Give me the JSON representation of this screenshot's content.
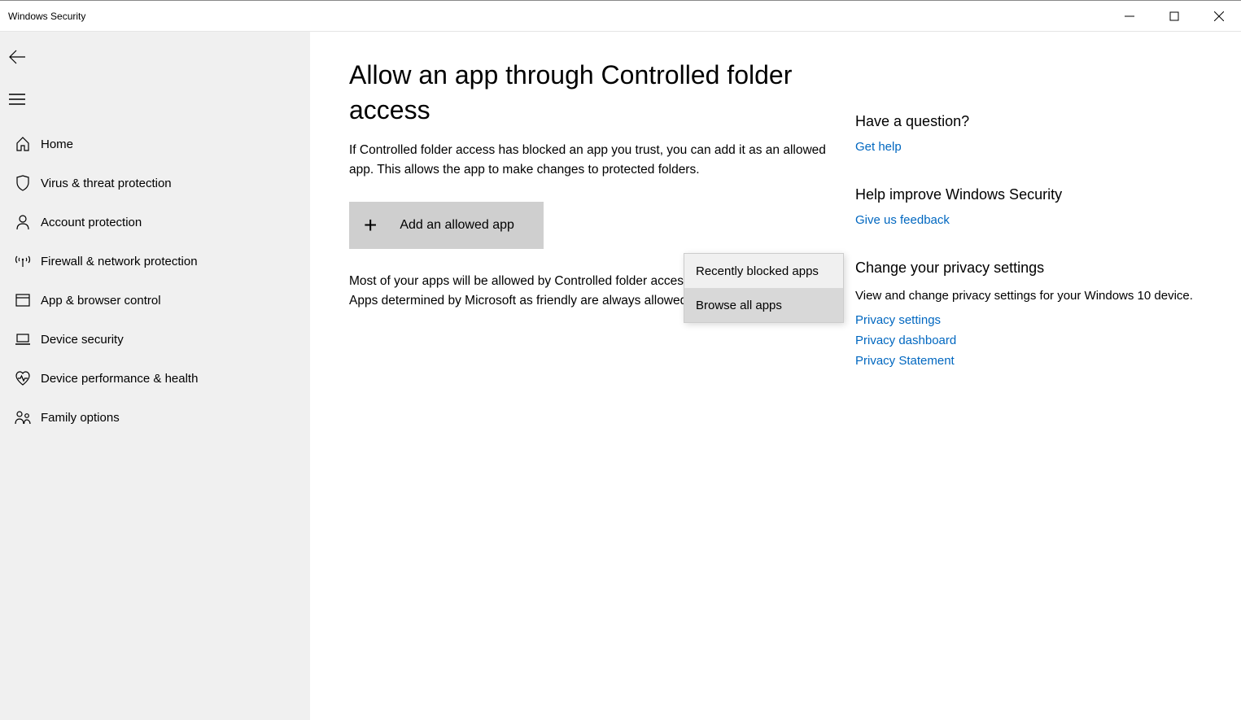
{
  "window": {
    "title": "Windows Security"
  },
  "sidebar": {
    "items": [
      {
        "label": "Home"
      },
      {
        "label": "Virus & threat protection"
      },
      {
        "label": "Account protection"
      },
      {
        "label": "Firewall & network protection"
      },
      {
        "label": "App & browser control"
      },
      {
        "label": "Device security"
      },
      {
        "label": "Device performance & health"
      },
      {
        "label": "Family options"
      }
    ]
  },
  "main": {
    "title": "Allow an app through Controlled folder access",
    "description": "If Controlled folder access has blocked an app you trust, you can add it as an allowed app. This allows the app to make changes to protected folders.",
    "add_button_label": "Add an allowed app",
    "sub_description": "Most of your apps will be allowed by Controlled folder access without adding them here. Apps determined by Microsoft as friendly are always allowed.",
    "dropdown": {
      "items": [
        "Recently blocked apps",
        "Browse all apps"
      ]
    }
  },
  "right": {
    "question": {
      "heading": "Have a question?",
      "link": "Get help"
    },
    "improve": {
      "heading": "Help improve Windows Security",
      "link": "Give us feedback"
    },
    "privacy": {
      "heading": "Change your privacy settings",
      "text": "View and change privacy settings for your Windows 10 device.",
      "links": [
        "Privacy settings",
        "Privacy dashboard",
        "Privacy Statement"
      ]
    }
  }
}
